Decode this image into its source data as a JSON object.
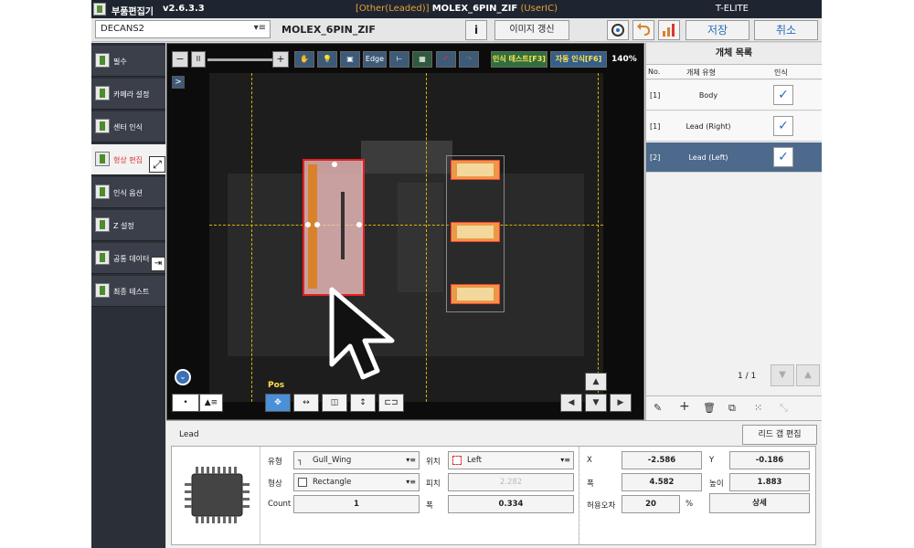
{
  "title_bar": {
    "app_name": "부품편집기",
    "version": "v2.6.3.3",
    "category": "[Other(Leaded)]",
    "part": "MOLEX_6PIN_ZIF",
    "user_tag": "(UserIC)",
    "brand": "T-ELITE"
  },
  "toolbar": {
    "machine": "DECANS2",
    "part_name": "MOLEX_6PIN_ZIF",
    "info_label": "i",
    "refresh_image_label": "이미지 갱신",
    "save_label": "저장",
    "cancel_label": "취소"
  },
  "sidebar": {
    "items": [
      {
        "label": "필수"
      },
      {
        "label": "카메라 설정"
      },
      {
        "label": "센터 인식"
      },
      {
        "label": "형상 편집"
      },
      {
        "label": "인식 옵션"
      },
      {
        "label": "Z 설정"
      },
      {
        "label": "공통 데이터"
      },
      {
        "label": "최종 테스트"
      }
    ]
  },
  "viewer": {
    "minus": "−",
    "plus": "+",
    "edge_label": "Edge",
    "recog_test_label": "인식 테스트[F3]",
    "auto_recog_label": "자동 인식[F6]",
    "zoom": "140%",
    "expand_label": ">",
    "pos_label": "Pos",
    "dot_label": "•",
    "menu_label": "▲≡"
  },
  "object_list": {
    "title": "개체 목록",
    "col_no": "No.",
    "col_type": "개체 유형",
    "col_recog": "인식",
    "rows": [
      {
        "no": "[1]",
        "type": "Body",
        "checked": true
      },
      {
        "no": "[1]",
        "type": "Lead (Right)",
        "checked": true
      },
      {
        "no": "[2]",
        "type": "Lead (Left)",
        "checked": true
      }
    ],
    "page": "1  /  1"
  },
  "lead_panel": {
    "title": "Lead",
    "lead_gap_edit": "리드 갭 편집",
    "type_label": "유형",
    "type_value": "Gull_Wing",
    "shape_label": "형상",
    "shape_value": "Rectangle",
    "count_label": "Count",
    "count_value": "1",
    "position_label": "위치",
    "position_value": "Left",
    "pitch_label": "피치",
    "pitch_value": "2.282",
    "width_label": "폭",
    "width_value": "0.334",
    "x_label": "X",
    "x_value": "-2.586",
    "y_label": "Y",
    "y_value": "-0.186",
    "w_label": "폭",
    "w_value": "4.582",
    "h_label": "높이",
    "h_value": "1.883",
    "tol_label": "허용오차",
    "tol_value": "20",
    "tol_unit": "%",
    "detail_label": "상세"
  },
  "colors": {
    "title_bg": "#1f2530",
    "accent_orange": "#e3a23b",
    "selection_red": "#e52020",
    "selected_row": "#4d6a8c"
  }
}
